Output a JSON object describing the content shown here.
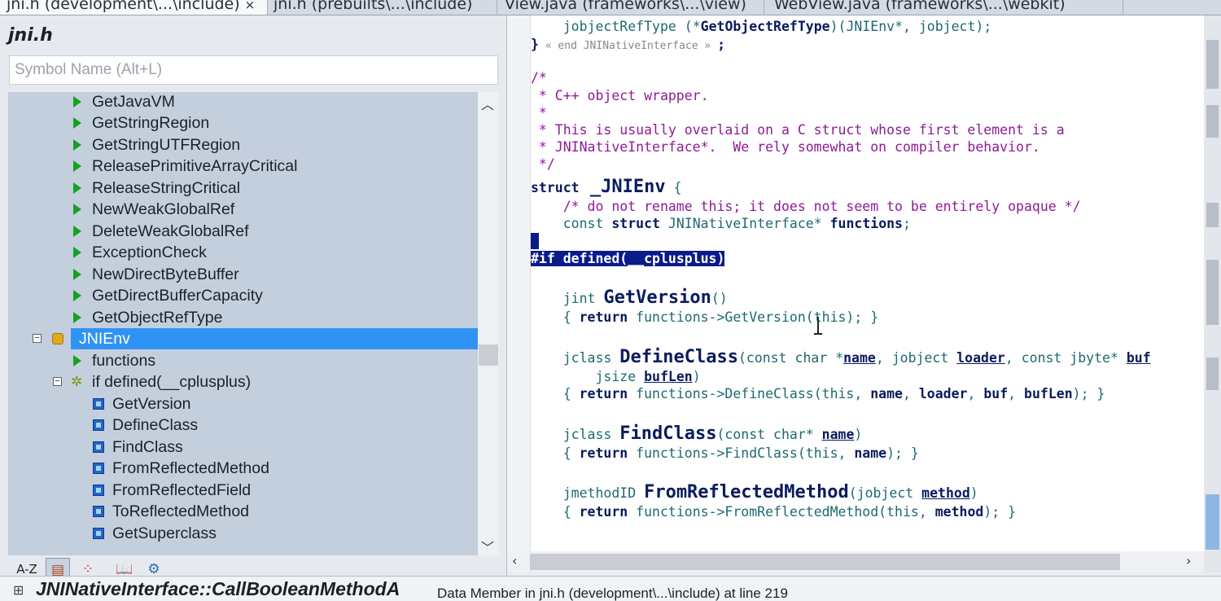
{
  "tabs": [
    {
      "label": "jni.h (development\\...\\include)",
      "close": "×"
    },
    {
      "label": "jni.h (prebuilts\\...\\include)"
    },
    {
      "label": "View.java (frameworks\\...\\view)"
    },
    {
      "label": "WebView.java (frameworks\\...\\webkit)"
    }
  ],
  "symbol_panel": {
    "file_title": "jni.h",
    "search_placeholder": "Symbol Name (Alt+L)",
    "items": [
      {
        "label": "GetJavaVM"
      },
      {
        "label": "GetStringRegion"
      },
      {
        "label": "GetStringUTFRegion"
      },
      {
        "label": "ReleasePrimitiveArrayCritical"
      },
      {
        "label": "ReleaseStringCritical"
      },
      {
        "label": "NewWeakGlobalRef"
      },
      {
        "label": "DeleteWeakGlobalRef"
      },
      {
        "label": "ExceptionCheck"
      },
      {
        "label": "NewDirectByteBuffer"
      },
      {
        "label": "GetDirectBufferCapacity"
      },
      {
        "label": "GetObjectRefType"
      },
      {
        "label": "JNIEnv"
      },
      {
        "label": "functions"
      },
      {
        "label": "if defined(__cplusplus)"
      },
      {
        "label": "GetVersion"
      },
      {
        "label": "DefineClass"
      },
      {
        "label": "FindClass"
      },
      {
        "label": "FromReflectedMethod"
      },
      {
        "label": "FromReflectedField"
      },
      {
        "label": "ToReflectedMethod"
      },
      {
        "label": "GetSuperclass"
      }
    ],
    "toolbar": {
      "az_label": "A-Z"
    }
  },
  "code": {
    "l1_indent": "    ",
    "l1_type": "jobjectRefType",
    "l1_open": " (*",
    "l1_name": "GetObjectRefType",
    "l1_args": ")(JNIEnv*, jobject);",
    "l2_brace": "}",
    "l2_note": " « end JNINativeInterface » ",
    "l2_semi": ";",
    "c1": "/*",
    "c2": " * C++ object wrapper.",
    "c3": " *",
    "c4": " * This is usually overlaid on a C struct whose first element is a",
    "c5": " * JNINativeInterface*.  We rely somewhat on compiler behavior.",
    "c6": " */",
    "struct_kw": "struct",
    "struct_name": " _JNIEnv",
    "struct_brace": " {",
    "rename_comment": "    /* do not rename this; it does not seem to be entirely opaque */",
    "fields_indent": "    ",
    "fields_const": "const",
    "fields_struct": " struct ",
    "fields_type": "JNINativeInterface*",
    "fields_name": " functions",
    "fields_semi": ";",
    "ifdef_hash": "#if",
    "ifdef_rest": " defined(__cplusplus)",
    "gv_type": "    jint ",
    "gv_name": "GetVersion",
    "gv_parens": "()",
    "gv_body_open": "    { ",
    "gv_return": "return",
    "gv_body": " functions->GetVersion(this); }",
    "dc_type": "    jclass ",
    "dc_name": "DefineClass",
    "dc_p1": "(const char *",
    "dc_name_param": "name",
    "dc_p2": ", jobject ",
    "dc_loader": "loader",
    "dc_p3": ", const jbyte* ",
    "dc_buf": "buf",
    "dc_l2a": "        jsize ",
    "dc_buflen": "bufLen",
    "dc_l2b": ")",
    "dc_body_open": "    { ",
    "dc_return": "return",
    "dc_body1": " functions->DefineClass(this, ",
    "dc_b_name": "name",
    "dc_b_sep1": ", ",
    "dc_b_loader": "loader",
    "dc_b_sep2": ", ",
    "dc_b_buf": "buf",
    "dc_b_sep3": ", ",
    "dc_b_buflen": "bufLen",
    "dc_body_end": "); }",
    "fc_type": "    jclass ",
    "fc_name": "FindClass",
    "fc_p1": "(const char* ",
    "fc_param": "name",
    "fc_p2": ")",
    "fc_body_open": "    { ",
    "fc_return": "return",
    "fc_body1": " functions->FindClass(this, ",
    "fc_b_name": "name",
    "fc_body_end": "); }",
    "frm_type": "    jmethodID ",
    "frm_name": "FromReflectedMethod",
    "frm_p1": "(jobject ",
    "frm_param": "method",
    "frm_p2": ")",
    "frm_body_open": "    { ",
    "frm_return": "return",
    "frm_body1": " functions->FromReflectedMethod(this, ",
    "frm_b_method": "method",
    "frm_body_end": "); }"
  },
  "status": {
    "symbol": "JNINativeInterface::CallBooleanMethodA",
    "detail": "Data Member in jni.h (development\\...\\include) at line 219"
  },
  "colors": {
    "selection": "#2f93f5",
    "tree_bg": "#c4cfdd",
    "highlight": "#0a1b8a",
    "comment": "#8f1a96",
    "keyword": "#0a1b5e"
  }
}
